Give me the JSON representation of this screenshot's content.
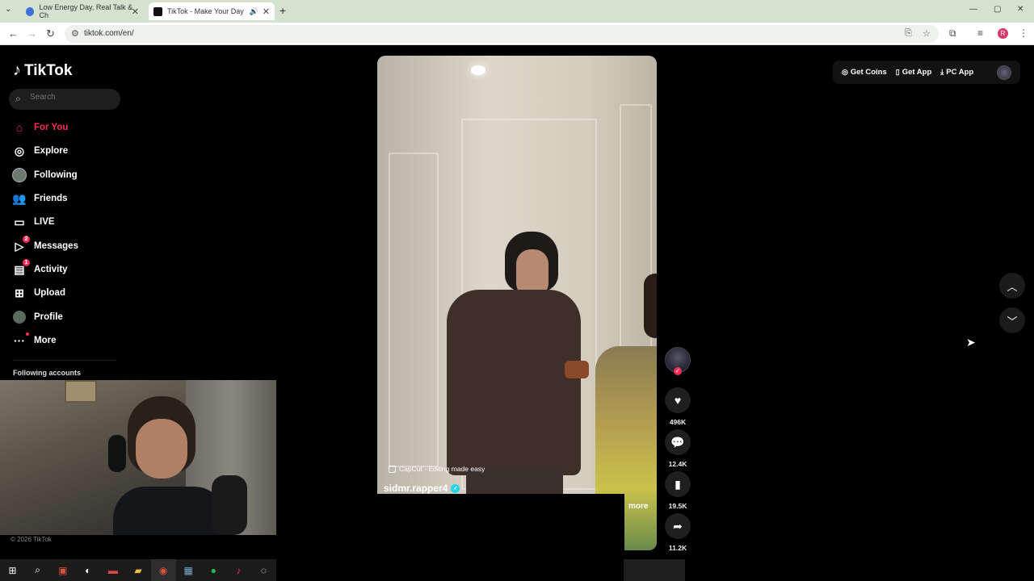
{
  "browser": {
    "tabs": [
      {
        "title": "Low Energy Day, Real Talk & Ch",
        "icon": "reddit-like-icon",
        "close": "✕"
      },
      {
        "title": "TikTok - Make Your Day",
        "icon": "tiktok-icon",
        "close": "✕"
      }
    ],
    "url": "tiktok.com/en/"
  },
  "sidebar": {
    "logo": "TikTok",
    "search_placeholder": "Search",
    "items": [
      {
        "label": "For You",
        "icon": "home-icon",
        "active": true
      },
      {
        "label": "Explore",
        "icon": "compass-icon"
      },
      {
        "label": "Following",
        "icon": "following-avatar-icon"
      },
      {
        "label": "Friends",
        "icon": "friends-icon"
      },
      {
        "label": "LIVE",
        "icon": "live-icon"
      },
      {
        "label": "Messages",
        "icon": "messages-icon",
        "badge": "2"
      },
      {
        "label": "Activity",
        "icon": "activity-icon",
        "badge": "1"
      },
      {
        "label": "Upload",
        "icon": "upload-icon"
      },
      {
        "label": "Profile",
        "icon": "profile-icon"
      },
      {
        "label": "More",
        "icon": "more-icon",
        "dot": true
      }
    ],
    "following_title": "Following accounts",
    "copyright": "© 2026 TikTok"
  },
  "video": {
    "watermark": "CapCut - Editing made easy",
    "username": "sidmr.rapper4",
    "more_label": "more",
    "actions": [
      {
        "name": "like",
        "icon": "heart-icon",
        "count": "496K"
      },
      {
        "name": "comment",
        "icon": "comment-icon",
        "count": "12.4K"
      },
      {
        "name": "save",
        "icon": "bookmark-icon",
        "count": "19.5K"
      },
      {
        "name": "share",
        "icon": "share-icon",
        "count": "11.2K"
      }
    ]
  },
  "topbar": {
    "get_coins": "Get Coins",
    "get_app": "Get App",
    "pc_app": "PC App"
  },
  "colors": {
    "accent": "#fe2c55",
    "background": "#000000"
  }
}
